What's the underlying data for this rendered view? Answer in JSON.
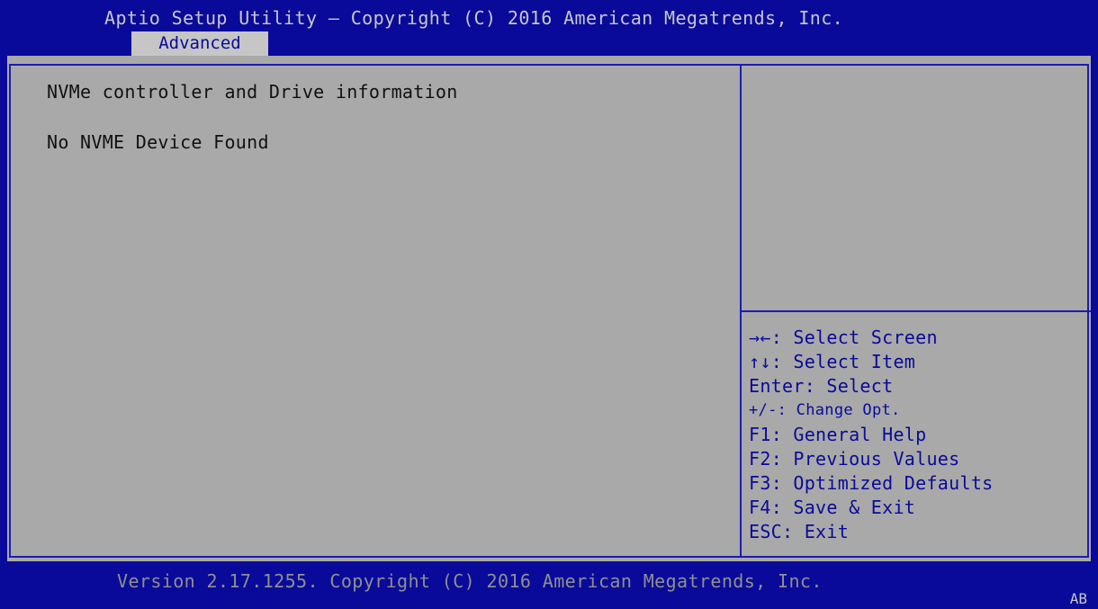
{
  "header": {
    "title": "Aptio Setup Utility – Copyright (C) 2016 American Megatrends, Inc.",
    "tabs": [
      {
        "label": "Advanced",
        "active": true
      }
    ]
  },
  "main": {
    "heading": "NVMe controller and Drive information",
    "status": "No NVME Device Found"
  },
  "help": {
    "description": "",
    "keys": [
      {
        "key": "→←",
        "action": ": Select Screen"
      },
      {
        "key": "↑↓",
        "action": ": Select Item"
      },
      {
        "key": "Enter",
        "action": ": Select"
      },
      {
        "key": "+/-",
        "action": ": Change Opt."
      },
      {
        "key": "F1",
        "action": ": General Help"
      },
      {
        "key": "F2",
        "action": ": Previous Values"
      },
      {
        "key": "F3",
        "action": ": Optimized Defaults"
      },
      {
        "key": "F4",
        "action": ": Save & Exit"
      },
      {
        "key": "ESC",
        "action": ": Exit"
      }
    ]
  },
  "footer": {
    "version": "Version 2.17.1255. Copyright (C) 2016 American Megatrends, Inc.",
    "code": "AB"
  },
  "colors": {
    "bios_blue": "#0a0a9a",
    "panel_gray": "#a9a9a9",
    "text_light": "#c6c6c6",
    "text_dark": "#111111",
    "footer_text": "#8f8f8f"
  }
}
